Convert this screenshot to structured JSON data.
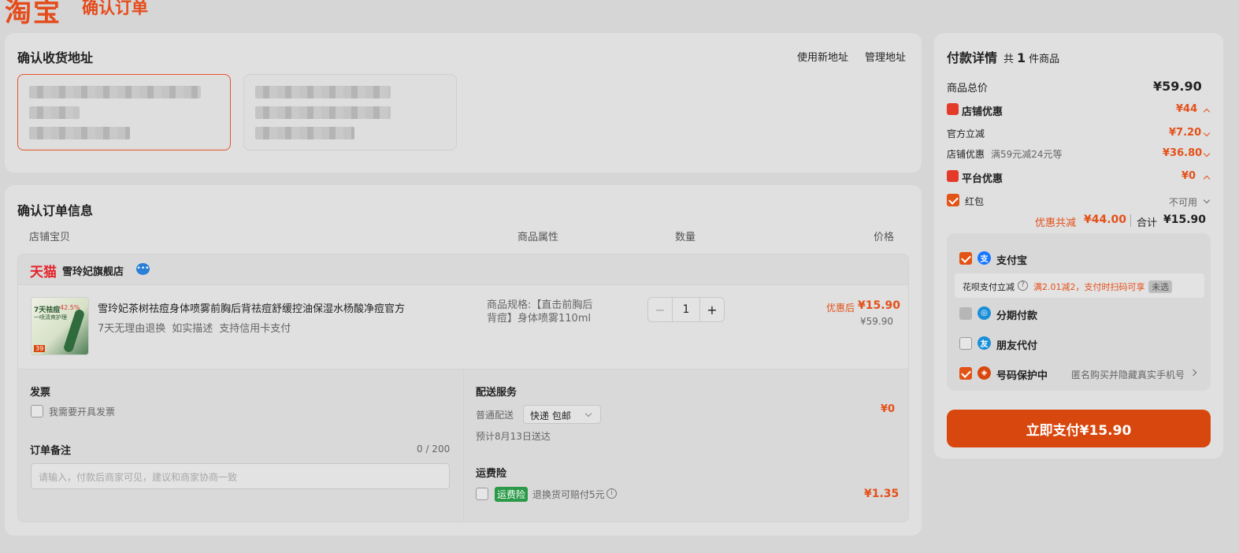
{
  "header": {
    "logo": "淘宝",
    "title": "确认订单"
  },
  "address": {
    "title": "确认收货地址",
    "new_link": "使用新地址",
    "manage_link": "管理地址"
  },
  "order": {
    "title": "确认订单信息",
    "columns": [
      "店铺宝贝",
      "商品属性",
      "数量",
      "价格"
    ],
    "shop": {
      "platform": "天猫",
      "name": "雪玲妃旗舰店"
    },
    "item": {
      "name": "雪玲妃茶树祛痘身体喷雾前胸后背祛痘舒缓控油保湿水杨酸净痘官方",
      "services": [
        "7天无理由退换",
        "如实描述",
        "支持信用卡支付"
      ],
      "spec": "商品规格:【直击前胸后背痘】身体喷雾110ml",
      "qty": "1",
      "minus": "−",
      "plus": "+",
      "discount_label": "优惠后",
      "discount_price": "¥15.90",
      "original_price": "¥59.90",
      "thumb_text": [
        "7天祛痘",
        "42.5%",
        "一喷清爽护理",
        "39"
      ]
    },
    "invoice": {
      "title": "发票",
      "checkbox_label": "我需要开具发票"
    },
    "remark": {
      "title": "订单备注",
      "counter": "0 / 200",
      "placeholder": "请输入，付款后商家可见，建议和商家协商一致"
    },
    "delivery": {
      "title": "配送服务",
      "type": "普通配送",
      "select_value": "快递 包邮",
      "eta": "预计8月13日送达",
      "price": "¥0"
    },
    "insurance": {
      "title": "运费险",
      "tag": "运费险",
      "desc": "退换货可赔付5元",
      "info": "i",
      "price": "¥1.35"
    }
  },
  "payment": {
    "title": "付款详情",
    "count_prefix": "共",
    "count": "1",
    "count_suffix": "件商品",
    "total_label": "商品总价",
    "total_value": "¥59.90",
    "shop_discount_label": "店铺优惠",
    "shop_discount_value": "¥44",
    "official_label": "官方立减",
    "official_value": "¥7.20",
    "shop_promo_label": "店铺优惠",
    "shop_promo_desc": "满59元减24元等",
    "shop_promo_value": "¥36.80",
    "platform_label": "平台优惠",
    "platform_value": "¥0",
    "redpack_label": "红包",
    "redpack_value": "不可用",
    "saved_label": "优惠共减",
    "saved_value": "¥44.00",
    "sum_label": "合计",
    "sum_value": "¥15.90",
    "methods": {
      "alipay": "支付宝",
      "huabei_label": "花呗支付立减",
      "huabei_help": "?",
      "huabei_promo": "满2.01减2，支付时扫码可享",
      "huabei_tag": "未选",
      "installment": "分期付款",
      "friend": "朋友代付",
      "privacy": "号码保护中",
      "privacy_desc": "匿名购买并隐藏真实手机号"
    },
    "pay_button": "立即支付¥15.90"
  },
  "colors": {
    "accent": "#e4501a",
    "tmall": "#e4262d",
    "alipay": "#1677ff",
    "green": "#2a9a48"
  }
}
